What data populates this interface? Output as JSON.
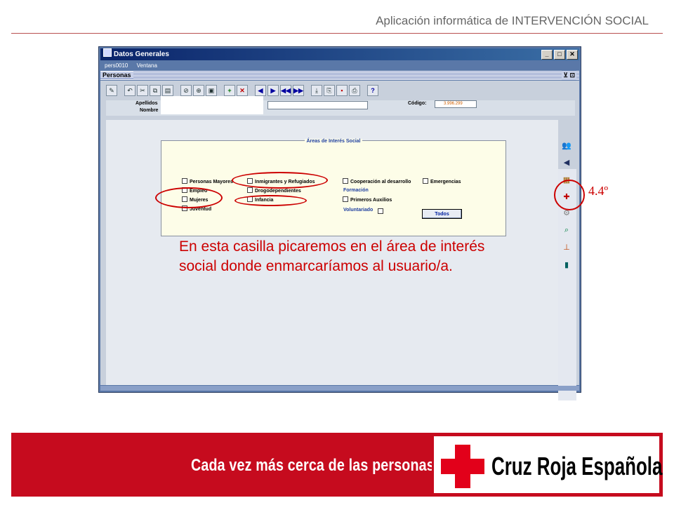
{
  "slide": {
    "title": "Aplicación informática de INTERVENCIÓN SOCIAL",
    "explanation": "En esta casilla picaremos en el área de interés social donde enmarcaríamos al usuario/a.",
    "step": "4.4º"
  },
  "window": {
    "title": "Datos Generales",
    "menu": [
      "pers0010",
      "Ventana"
    ],
    "inner_title": "Personas",
    "inner_controls": "⊻ ⊡",
    "controls": [
      "_",
      "□",
      "✕"
    ]
  },
  "toolbar_icons": [
    "edit-icon",
    "undo-icon",
    "cut-icon",
    "copy-icon",
    "paste-icon",
    "clear-icon",
    "duplicate-icon",
    "copy-record-icon",
    "insert-record-icon",
    "delete-record-icon",
    "previous-icon",
    "next-icon",
    "first-icon",
    "last-icon",
    "download-icon",
    "exit-icon",
    "save-icon",
    "print-icon",
    "help-icon"
  ],
  "form": {
    "apellidos_label": "Apellidos",
    "nombre_label": "Nombre",
    "codigo_label": "Código:",
    "codigo_value": "3.996.299"
  },
  "interest_panel": {
    "title": "Áreas de Interés Social",
    "items": {
      "personas_mayores": "Personas Mayores",
      "empleo": "Empleo",
      "mujeres": "Mujeres",
      "juventud": "Juventud",
      "inmigrantes": "Inmigrantes y Refugiados",
      "drogodependientes": "Drogodependientes",
      "infancia": "Infancia",
      "cooperacion": "Cooperación al desarrollo",
      "emergencias": "Emergencias",
      "primeros_auxilios": "Primeros Auxilios"
    },
    "formacion_label": "Formación",
    "voluntariado_label": "Voluntariado",
    "todos_button": "Todos"
  },
  "side_icons": [
    "people-icon",
    "megaphone-icon",
    "interest-areas-icon",
    "tools-icon",
    "search-icon",
    "hierarchy-icon",
    "exit-door-icon"
  ],
  "footer": {
    "tagline": "Cada vez más cerca de las personas",
    "logo_text": "Cruz Roja Española"
  },
  "colors": {
    "brand_red": "#c60b1e",
    "highlight_red": "#cc0000",
    "window_blue": "#5a78a8"
  }
}
